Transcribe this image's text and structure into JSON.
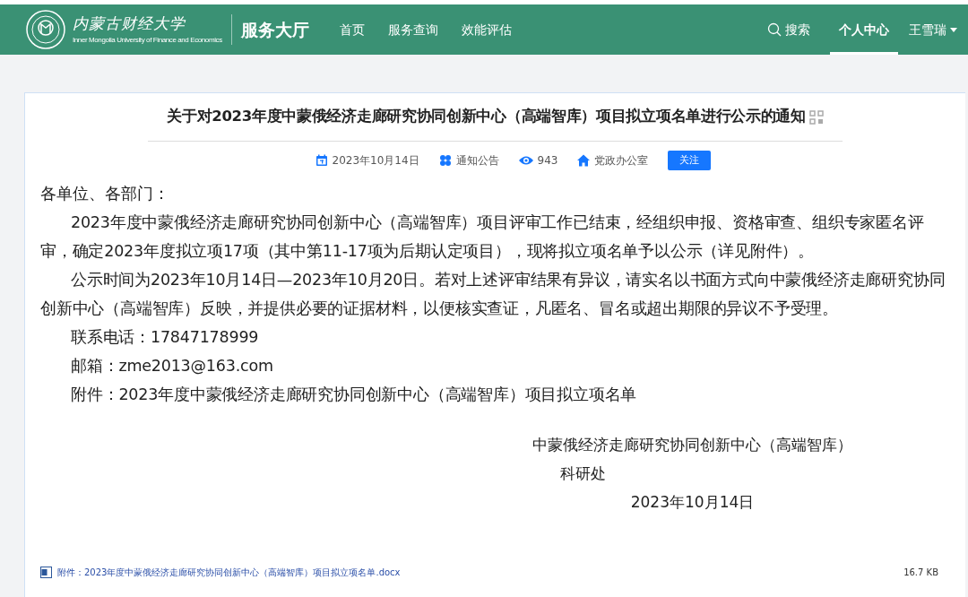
{
  "header": {
    "logo": {
      "name": "内蒙古财经大学",
      "english": "Inner Mongolia University of Finance and Economics"
    },
    "site_title": "服务大厅",
    "nav": [
      {
        "label": "首页",
        "selected": false
      },
      {
        "label": "服务查询",
        "selected": false
      },
      {
        "label": "效能评估",
        "selected": false
      }
    ],
    "search": "搜索",
    "user_nav": {
      "label": "个人中心",
      "selected": true
    },
    "user": "王雪瑞"
  },
  "article": {
    "title": "关于对2023年度中蒙俄经济走廊研究协同创新中心（高端智库）项目拟立项名单进行公示的通知",
    "meta": [
      {
        "kind": "date",
        "text": "2023年10月14日"
      },
      {
        "kind": "category",
        "text": "通知公告"
      },
      {
        "kind": "views",
        "text": "943"
      },
      {
        "kind": "department",
        "text": "党政办公室"
      }
    ],
    "follow_button": "关注",
    "salutation": "各单位、各部门：",
    "paragraphs": [
      "2023年度中蒙俄经济走廊研究协同创新中心（高端智库）项目评审工作已结束，经组织申报、资格审查、组织专家匿名评审，确定2023年度拟立项17项（其中第11-17项为后期认定项目），现将拟立项名单予以公示（详见附件）。",
      "公示时间为2023年10月14日—2023年10月20日。若对上述评审结果有异议，请实名以书面方式向中蒙俄经济走廊研究协同创新中心（高端智库）反映，并提供必要的证据材料，以便核实查证，凡匿名、冒名或超出期限的异议不予受理。",
      "联系电话：17847178999",
      "邮箱：zme2013@163.com",
      "附件：2023年度中蒙俄经济走廊研究协同创新中心（高端智库）项目拟立项名单"
    ],
    "signature": [
      "中蒙俄经济走廊研究协同创新中心（高端智库）",
      "科研处",
      "2023年10月14日"
    ],
    "attachment": {
      "name": "附件：2023年度中蒙俄经济走廊研究协同创新中心（高端智库）项目拟立项名单.docx",
      "size": "16.7 KB"
    }
  }
}
